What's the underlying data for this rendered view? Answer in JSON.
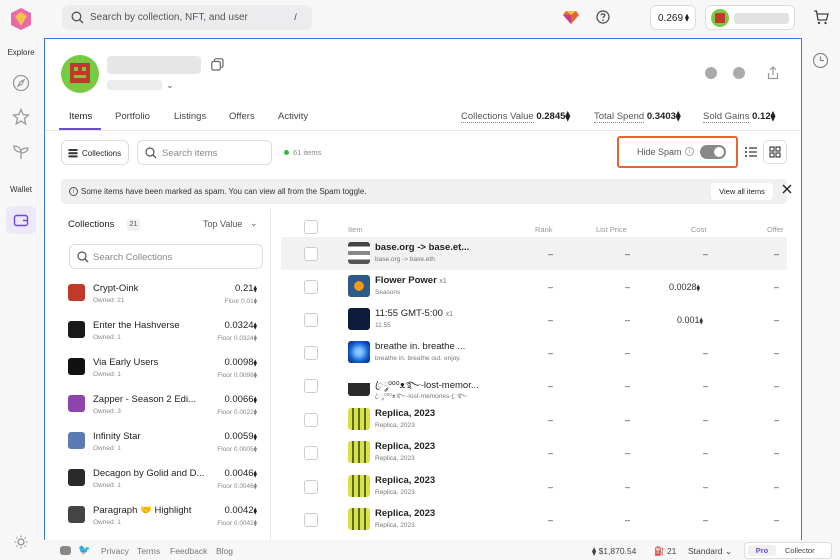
{
  "nav": {
    "explore_label": "Explore",
    "wallet_label": "Wallet"
  },
  "search": {
    "placeholder": "Search by collection, NFT, and user",
    "shortcut": "/"
  },
  "header": {
    "balance": "0.269"
  },
  "profile": {
    "tabs": [
      "Items",
      "Portfolio",
      "Listings",
      "Offers",
      "Activity"
    ],
    "active_tab": "Items",
    "stats": [
      {
        "label": "Collections Value",
        "value": "0.2845"
      },
      {
        "label": "Total Spend",
        "value": "0.3403"
      },
      {
        "label": "Sold Gains",
        "value": "0.12"
      }
    ]
  },
  "toolbar": {
    "collections_label": "Collections",
    "search_placeholder": "Search items",
    "count": "61 items",
    "hide_spam_label": "Hide Spam",
    "hide_spam_on": true
  },
  "notice": {
    "text": "Some items have been marked as spam. You can view all from the Spam toggle.",
    "view_all": "View all items"
  },
  "collections_panel": {
    "title": "Collections",
    "count": "21",
    "sort": "Top Value",
    "search_placeholder": "Search Collections"
  },
  "collections": [
    {
      "name": "Crypt-Oink",
      "owned": "Owned: 21",
      "price": "0.21",
      "floor": "Floor 0.01"
    },
    {
      "name": "Enter the Hashverse",
      "owned": "Owned: 1",
      "price": "0.0324",
      "floor": "Floor 0.0324"
    },
    {
      "name": "Via Early Users",
      "owned": "Owned: 1",
      "price": "0.0098",
      "floor": "Floor 0.0098"
    },
    {
      "name": "Zapper - Season 2 Edi...",
      "owned": "Owned: 3",
      "price": "0.0066",
      "floor": "Floor 0.0022"
    },
    {
      "name": "Infinity Star",
      "owned": "Owned: 1",
      "price": "0.0059",
      "floor": "Floor 0.0005"
    },
    {
      "name": "Decagon by Golid and D...",
      "owned": "Owned: 1",
      "price": "0.0046",
      "floor": "Floor 0.0046"
    },
    {
      "name": "Paragraph 🤝 Highlight",
      "owned": "Owned: 1",
      "price": "0.0042",
      "floor": "Floor 0.0042"
    }
  ],
  "table": {
    "columns": [
      "Item",
      "Rank",
      "List Price",
      "Cost",
      "Offer"
    ],
    "rows": [
      {
        "name": "base.org -> base.et...",
        "sub": "base.org -> base.eth",
        "qty": "",
        "rank": "–",
        "list": "–",
        "cost": "–",
        "offer": "–"
      },
      {
        "name": "Flower Power",
        "sub": "Seasons",
        "qty": "x1",
        "rank": "–",
        "list": "–",
        "cost": "0.0028",
        "offer": "–"
      },
      {
        "name": "11:55 GMT-5:00",
        "sub": "11:55",
        "qty": "x1",
        "rank": "–",
        "list": "–",
        "cost": "0.001",
        "offer": "–"
      },
      {
        "name": "breathe in. breathe ...",
        "sub": "breathe in. breathe out. enjoy.",
        "qty": "",
        "rank": "–",
        "list": "–",
        "cost": "–",
        "offer": "–"
      },
      {
        "name": "ꦿ༘⁰⁰⁰ᴥ࿐-lost-memor...",
        "sub": "ꦿ༘⁰⁰⁰ᴥ࿐-lost-memories-ꦿ࿐",
        "qty": "",
        "rank": "–",
        "list": "–",
        "cost": "–",
        "offer": "–"
      },
      {
        "name": "Replica, 2023",
        "sub": "Replica, 2023",
        "qty": "",
        "rank": "–",
        "list": "–",
        "cost": "–",
        "offer": "–"
      },
      {
        "name": "Replica, 2023",
        "sub": "Replica, 2023",
        "qty": "",
        "rank": "–",
        "list": "–",
        "cost": "–",
        "offer": "–"
      },
      {
        "name": "Replica, 2023",
        "sub": "Replica, 2023",
        "qty": "",
        "rank": "–",
        "list": "–",
        "cost": "–",
        "offer": "–"
      },
      {
        "name": "Replica, 2023",
        "sub": "Replica, 2023",
        "qty": "",
        "rank": "–",
        "list": "–",
        "cost": "–",
        "offer": "–"
      }
    ]
  },
  "footer": {
    "links": [
      "Privacy",
      "Terms",
      "Feedback",
      "Blog"
    ],
    "eth_price": "$1,870.54",
    "gas": "21",
    "mode": "Standard",
    "pro": "Pro",
    "collector": "Collector"
  },
  "colors": {
    "accent": "#6c4bd3",
    "highlight": "#e8652b",
    "border": "#3a7bd5"
  }
}
